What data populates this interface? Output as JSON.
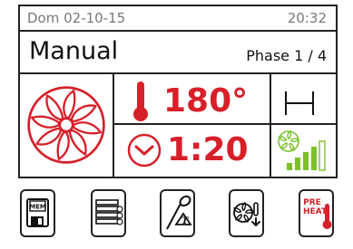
{
  "status": {
    "date": "Dom 02-10-15",
    "time": "20:32"
  },
  "header": {
    "mode": "Manual",
    "phase": "Phase 1 / 4"
  },
  "cooking": {
    "temperature": "180°",
    "time": "1:20",
    "fan_speed_level": 4,
    "fan_speed_max": 5
  },
  "softkeys": {
    "memory_label": "MEM",
    "preheat_label_line1": "PRE",
    "preheat_label_line2": "HEAT"
  },
  "colors": {
    "accent_red": "#d6202a",
    "fan_speed_green": "#7cc02a",
    "border": "#222222",
    "status_text": "#777777"
  },
  "icons": [
    "convection-fan-icon",
    "thermometer-icon",
    "timer-icon",
    "bracket-icon",
    "fan-speed-icon",
    "memory-icon",
    "programs-list-icon",
    "core-probe-icon",
    "fan-cooling-icon",
    "preheat-icon"
  ]
}
